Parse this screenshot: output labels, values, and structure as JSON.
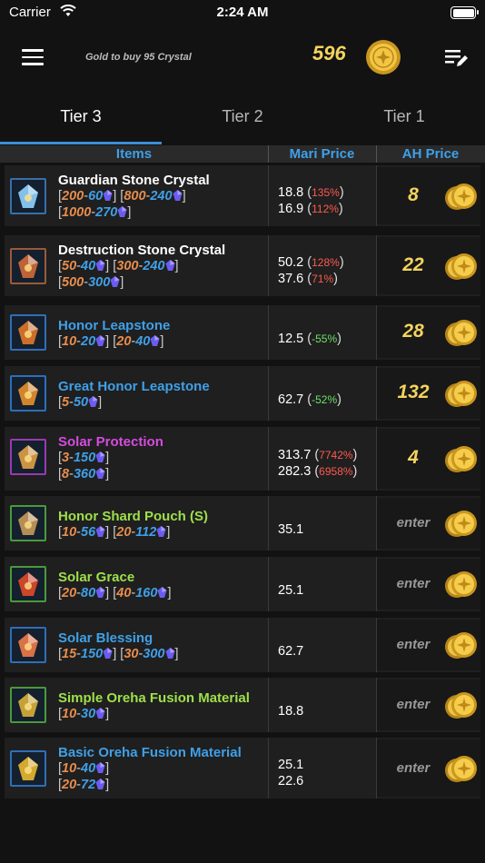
{
  "status_bar": {
    "carrier": "Carrier",
    "time": "2:24 AM"
  },
  "header": {
    "gold_caption": "Gold to buy 95 Crystal",
    "gold_value": "596"
  },
  "tabs": [
    {
      "label": "Tier 3",
      "active": true
    },
    {
      "label": "Tier 2",
      "active": false
    },
    {
      "label": "Tier 1",
      "active": false
    }
  ],
  "columns": {
    "items": "Items",
    "mari": "Mari Price",
    "ah": "AH Price"
  },
  "colors": {
    "accent": "#3a8fd8",
    "gold": "#f4d35e",
    "pct_up": "#ff5a4e",
    "pct_down": "#6fe06a"
  },
  "rows": [
    {
      "name": "Guardian Stone Crystal",
      "name_color": "#ffffff",
      "icon": "guardian-stone-crystal-icon",
      "frame": "#3a6fa8",
      "qty_lines": [
        [
          [
            "200",
            "60"
          ],
          [
            "800",
            "240"
          ]
        ],
        [
          [
            "1000",
            "270"
          ]
        ]
      ],
      "mari": [
        {
          "value": "18.8",
          "pct": "135%",
          "dir": "up"
        },
        {
          "value": "16.9",
          "pct": "112%",
          "dir": "up"
        }
      ],
      "ah": "8"
    },
    {
      "name": "Destruction Stone Crystal",
      "name_color": "#ffffff",
      "icon": "destruction-stone-crystal-icon",
      "frame": "#9a5a3a",
      "qty_lines": [
        [
          [
            "50",
            "40"
          ],
          [
            "300",
            "240"
          ]
        ],
        [
          [
            "500",
            "300"
          ]
        ]
      ],
      "mari": [
        {
          "value": "50.2",
          "pct": "128%",
          "dir": "up"
        },
        {
          "value": "37.6",
          "pct": "71%",
          "dir": "up"
        }
      ],
      "ah": "22"
    },
    {
      "name": "Honor Leapstone",
      "name_color": "#3fa0e8",
      "icon": "honor-leapstone-icon",
      "frame": "#2f6eb8",
      "qty_lines": [
        [
          [
            "10",
            "20"
          ],
          [
            "20",
            "40"
          ]
        ]
      ],
      "mari": [
        {
          "value": "12.5",
          "pct": "-55%",
          "dir": "down"
        }
      ],
      "ah": "28"
    },
    {
      "name": "Great Honor Leapstone",
      "name_color": "#3fa0e8",
      "icon": "great-honor-leapstone-icon",
      "frame": "#2f6eb8",
      "qty_lines": [
        [
          [
            "5",
            "50"
          ]
        ]
      ],
      "mari": [
        {
          "value": "62.7",
          "pct": "-52%",
          "dir": "down"
        }
      ],
      "ah": "132"
    },
    {
      "name": "Solar Protection",
      "name_color": "#d64be0",
      "icon": "solar-protection-icon",
      "frame": "#9a3ab0",
      "qty_lines": [
        [
          [
            "3",
            "150"
          ]
        ],
        [
          [
            "8",
            "360"
          ]
        ]
      ],
      "mari": [
        {
          "value": "313.7",
          "pct": "7742%",
          "dir": "up"
        },
        {
          "value": "282.3",
          "pct": "6958%",
          "dir": "up"
        }
      ],
      "ah": "4"
    },
    {
      "name": "Honor Shard Pouch (S)",
      "name_color": "#9ee04a",
      "icon": "honor-shard-pouch-icon",
      "frame": "#4a9a3a",
      "qty_lines": [
        [
          [
            "10",
            "56"
          ],
          [
            "20",
            "112"
          ]
        ]
      ],
      "mari": [
        {
          "value": "35.1"
        }
      ],
      "ah": "enter"
    },
    {
      "name": "Solar Grace",
      "name_color": "#9ee04a",
      "icon": "solar-grace-icon",
      "frame": "#4a9a3a",
      "qty_lines": [
        [
          [
            "20",
            "80"
          ],
          [
            "40",
            "160"
          ]
        ]
      ],
      "mari": [
        {
          "value": "25.1"
        }
      ],
      "ah": "enter"
    },
    {
      "name": "Solar Blessing",
      "name_color": "#3fa0e8",
      "icon": "solar-blessing-icon",
      "frame": "#2f6eb8",
      "qty_lines": [
        [
          [
            "15",
            "150"
          ],
          [
            "30",
            "300"
          ]
        ]
      ],
      "mari": [
        {
          "value": "62.7"
        }
      ],
      "ah": "enter"
    },
    {
      "name": "Simple Oreha Fusion Material",
      "name_color": "#9ee04a",
      "icon": "simple-oreha-fusion-icon",
      "frame": "#4a9a3a",
      "qty_lines": [
        [
          [
            "10",
            "30"
          ]
        ]
      ],
      "mari": [
        {
          "value": "18.8"
        }
      ],
      "ah": "enter"
    },
    {
      "name": "Basic Oreha Fusion Material",
      "name_color": "#3fa0e8",
      "icon": "basic-oreha-fusion-icon",
      "frame": "#2f6eb8",
      "qty_lines": [
        [
          [
            "10",
            "40"
          ]
        ],
        [
          [
            "20",
            "72"
          ]
        ]
      ],
      "mari": [
        {
          "value": "25.1"
        },
        {
          "value": "22.6"
        }
      ],
      "ah": "enter"
    }
  ]
}
